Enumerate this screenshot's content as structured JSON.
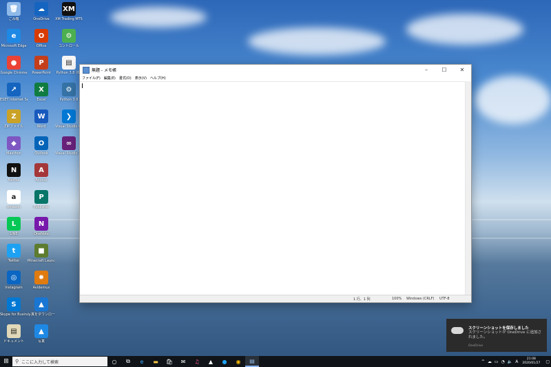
{
  "desktop": {
    "icons": [
      {
        "label": "ごみ箱",
        "color": "#8fb9e8",
        "glyph": "🗑",
        "icon": "recycle-bin-icon"
      },
      {
        "label": "Microsoft Edge",
        "color": "#1e88e5",
        "glyph": "e",
        "icon": "edge-icon"
      },
      {
        "label": "Google Chrome",
        "color": "#ea4335",
        "glyph": "●",
        "icon": "chrome-icon"
      },
      {
        "label": "ESET Internet Securi...",
        "color": "#1565c0",
        "glyph": "↗",
        "icon": "eset-icon"
      },
      {
        "label": "ZIPファイル",
        "color": "#c9a227",
        "glyph": "Z",
        "icon": "zip-folder-icon"
      },
      {
        "label": "Maxthon",
        "color": "#7e57c2",
        "glyph": "◆",
        "icon": "maxthon-icon"
      },
      {
        "label": "Netflix",
        "color": "#111111",
        "glyph": "N",
        "icon": "netflix-icon"
      },
      {
        "label": "Amazon",
        "color": "#ffffff",
        "glyph": "a",
        "icon": "amazon-icon"
      },
      {
        "label": "LINE",
        "color": "#06c755",
        "glyph": "L",
        "icon": "line-icon"
      },
      {
        "label": "Twitter",
        "color": "#1da1f2",
        "glyph": "t",
        "icon": "twitter-icon"
      },
      {
        "label": "Instagram",
        "color": "#0a66c2",
        "glyph": "◎",
        "icon": "instagram-icon"
      },
      {
        "label": "Skype for Business",
        "color": "#0078d4",
        "glyph": "S",
        "icon": "skype-icon"
      },
      {
        "label": "ドキュメント",
        "color": "#e0d8b8",
        "glyph": "▤",
        "icon": "document-folder-icon"
      },
      {
        "label": "OneDrive",
        "color": "#1565c0",
        "glyph": "☁",
        "icon": "onedrive-icon"
      },
      {
        "label": "Office",
        "color": "#d83b01",
        "glyph": "O",
        "icon": "office-icon"
      },
      {
        "label": "PowerPoint",
        "color": "#c43e1c",
        "glyph": "P",
        "icon": "powerpoint-icon"
      },
      {
        "label": "Excel",
        "color": "#107c41",
        "glyph": "X",
        "icon": "excel-icon"
      },
      {
        "label": "Word",
        "color": "#185abd",
        "glyph": "W",
        "icon": "word-icon"
      },
      {
        "label": "Outlook",
        "color": "#0364b8",
        "glyph": "O",
        "icon": "outlook-icon"
      },
      {
        "label": "Access",
        "color": "#a4373a",
        "glyph": "A",
        "icon": "access-icon"
      },
      {
        "label": "Publisher",
        "color": "#077568",
        "glyph": "P",
        "icon": "publisher-icon"
      },
      {
        "label": "OneNote",
        "color": "#7719aa",
        "glyph": "N",
        "icon": "onenote-icon"
      },
      {
        "label": "Minecraft Launcher",
        "color": "#5d7c2f",
        "glyph": "■",
        "icon": "minecraft-icon"
      },
      {
        "label": "Avidemux",
        "color": "#e07b10",
        "glyph": "✹",
        "icon": "avidemux-icon"
      },
      {
        "label": "写真をダウンロード",
        "color": "#1976d2",
        "glyph": "▲",
        "icon": "photo-download-icon"
      },
      {
        "label": "写真",
        "color": "#1e88e5",
        "glyph": "▲",
        "icon": "photos-icon"
      },
      {
        "label": "XM Trading MT5",
        "color": "#111111",
        "glyph": "XM",
        "icon": "xm-trading-icon"
      },
      {
        "label": "コントロール",
        "color": "#4caf50",
        "glyph": "⚙",
        "icon": "control-panel-icon"
      },
      {
        "label": "Python 3.8 (64",
        "color": "#f5f5f5",
        "glyph": "▤",
        "icon": "python-file-icon"
      },
      {
        "label": "Python 3.8",
        "color": "#3572a5",
        "glyph": "⚙",
        "icon": "python-icon"
      },
      {
        "label": "Visual Studio Code",
        "color": "#0078d4",
        "glyph": "❯",
        "icon": "vscode-icon"
      },
      {
        "label": "Visual Studio 2019",
        "color": "#68217a",
        "glyph": "∞",
        "icon": "visual-studio-icon"
      }
    ]
  },
  "notepad": {
    "title": "無題 - メモ帳",
    "menu": [
      "ファイル(F)",
      "編集(E)",
      "書式(O)",
      "表示(V)",
      "ヘルプ(H)"
    ],
    "status": {
      "position": "1 行、1 列",
      "zoom": "100%",
      "line_ending": "Windows (CRLF)",
      "encoding": "UTF-8"
    }
  },
  "toast": {
    "title": "スクリーンショットを保存しました",
    "body": "スクリーンショットが OneDrive に追加されました。",
    "source": "OneDrive"
  },
  "taskbar": {
    "search_placeholder": "ここに入力して検索",
    "apps": [
      "cortana-icon",
      "task-view-icon",
      "edge-icon",
      "file-explorer-icon",
      "store-icon",
      "mail-icon",
      "itunes-icon",
      "photos-icon",
      "twitter-icon",
      "chrome-icon",
      "notepad-icon"
    ],
    "ime": "A",
    "time": "21:08",
    "date": "2020/01/27"
  }
}
